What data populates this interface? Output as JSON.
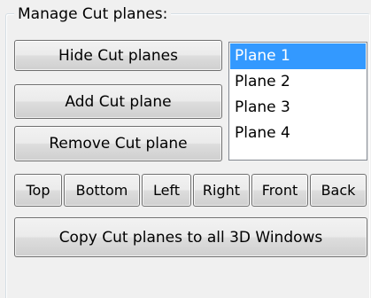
{
  "group": {
    "title": "Manage Cut planes:"
  },
  "buttons": {
    "hide": "Hide Cut planes",
    "add": "Add Cut plane",
    "remove": "Remove Cut plane",
    "copy": "Copy Cut planes to all 3D Windows"
  },
  "view_buttons": [
    "Top",
    "Bottom",
    "Left",
    "Right",
    "Front",
    "Back"
  ],
  "planes": {
    "items": [
      "Plane 1",
      "Plane 2",
      "Plane 3",
      "Plane 4"
    ],
    "selected": "Plane 1"
  },
  "colors": {
    "selection": "#3399ff",
    "background": "#f0f0f0"
  }
}
